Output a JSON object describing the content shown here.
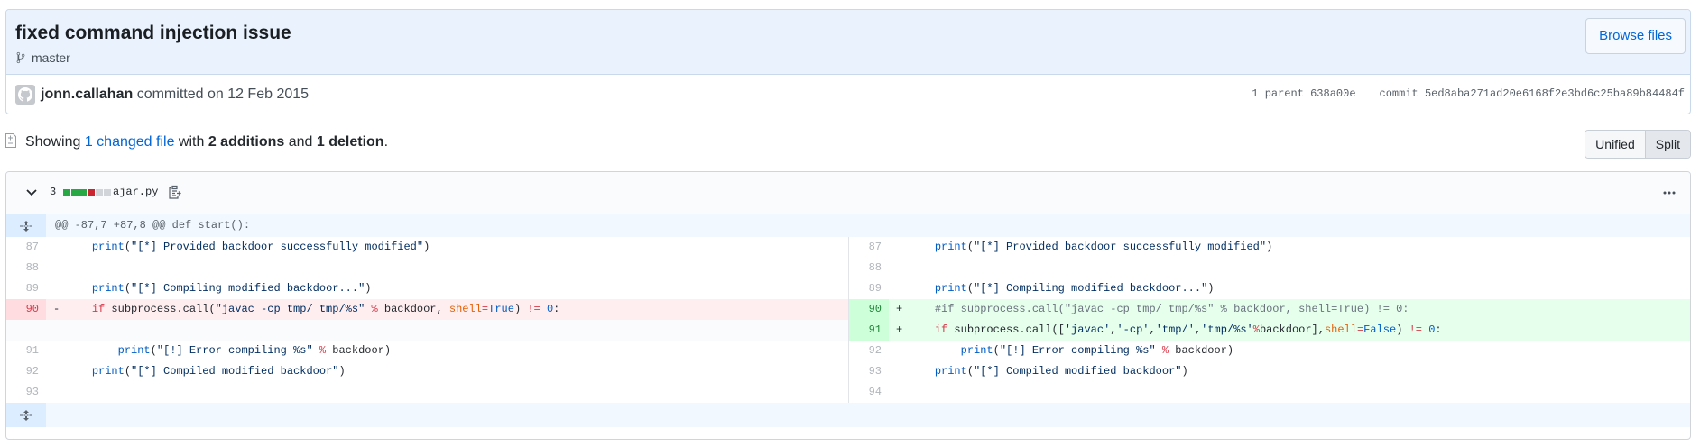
{
  "commit": {
    "title": "fixed command injection issue",
    "branch": "master",
    "browse_files": "Browse files",
    "author": "jonn.callahan",
    "committed_text": "committed on 12 Feb 2015",
    "parent_label": "1 parent",
    "parent_sha": "638a00e",
    "commit_label": "commit",
    "commit_sha": "5ed8aba271ad20e6168f2e3bd6c25ba89b84484f"
  },
  "toc": {
    "showing": "Showing",
    "changed_files": "1 changed file",
    "with": "with",
    "additions": "2 additions",
    "and": "and",
    "deletions": "1 deletion",
    "period": ".",
    "unified_label": "Unified",
    "split_label": "Split"
  },
  "file": {
    "changes": "3",
    "name": "ajar.py",
    "diffstat_colors": [
      "#28a745",
      "#28a745",
      "#28a745",
      "#cb2431",
      "#d1d5da",
      "#d1d5da"
    ],
    "hunk_header": "@@ -87,7 +87,8 @@ def start():",
    "lines": {
      "l87": "87",
      "l88": "88",
      "l89": "89",
      "l90": "90",
      "l91": "91",
      "l92": "92",
      "l93": "93",
      "r87": "87",
      "r88": "88",
      "r89": "89",
      "r90": "90",
      "r91": "91",
      "r92": "92",
      "r93": "93",
      "r94": "94",
      "minus": "-",
      "plus": "+"
    },
    "code": {
      "print": "print",
      "open_paren": "(",
      "close_paren": ")",
      "s_provided": "\"[*] Provided backdoor successfully modified\"",
      "s_compiling": "\"[*] Compiling modified backdoor...\"",
      "kw_if": "if",
      "subprocess_call": " subprocess.call(",
      "s_javac_old": "\"javac -cp tmp/ tmp/%s\"",
      "pct": "%",
      "backdoor_arg": " backdoor, ",
      "shell": "shell",
      "eq": "=",
      "true": "True",
      "neq": "!=",
      "zero": "0",
      "colon": ":",
      "space": " ",
      "comment_line": "#if subprocess.call(\"javac -cp tmp/ tmp/%s\" % backdoor, shell=True) != 0:",
      "list_open": "([",
      "s_javac": "'javac'",
      "comma": ",",
      "s_cp": "'-cp'",
      "s_tmp": "'tmp/'",
      "s_tmp_s": "'tmp/%s'",
      "backdoor_close": "backdoor],",
      "false": "False",
      "s_error": "\"[!] Error compiling %s\"",
      "backdoor_tail": " backdoor)",
      "s_compiled": "\"[*] Compiled modified backdoor\""
    }
  },
  "icons": {
    "branch": "git-branch-icon",
    "avatar": "github-avatar-icon",
    "toc": "file-diff-icon",
    "chevron": "chevron-down-icon",
    "clipboard": "clippy-icon",
    "more": "kebab-horizontal-icon",
    "expand": "unfold-icon"
  }
}
